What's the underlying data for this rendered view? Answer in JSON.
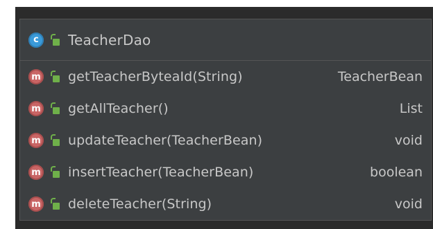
{
  "colors": {
    "background": "#3c3f41",
    "border": "#555555",
    "text": "#c8c8c8",
    "class_badge": "#3a9ad9",
    "method_badge": "#c96565",
    "public_lock": "#6fb04a"
  },
  "class_node": {
    "badge_letter": "c",
    "badge_icon": "class-icon",
    "visibility_icon": "public-lock-icon",
    "name": "TeacherDao"
  },
  "methods": [
    {
      "badge_letter": "m",
      "name": "getTeacherByteaId(String)",
      "return_type": "TeacherBean"
    },
    {
      "badge_letter": "m",
      "name": "getAllTeacher()",
      "return_type": "List"
    },
    {
      "badge_letter": "m",
      "name": "updateTeacher(TeacherBean)",
      "return_type": "void"
    },
    {
      "badge_letter": "m",
      "name": "insertTeacher(TeacherBean)",
      "return_type": "boolean"
    },
    {
      "badge_letter": "m",
      "name": "deleteTeacher(String)",
      "return_type": "void"
    }
  ]
}
